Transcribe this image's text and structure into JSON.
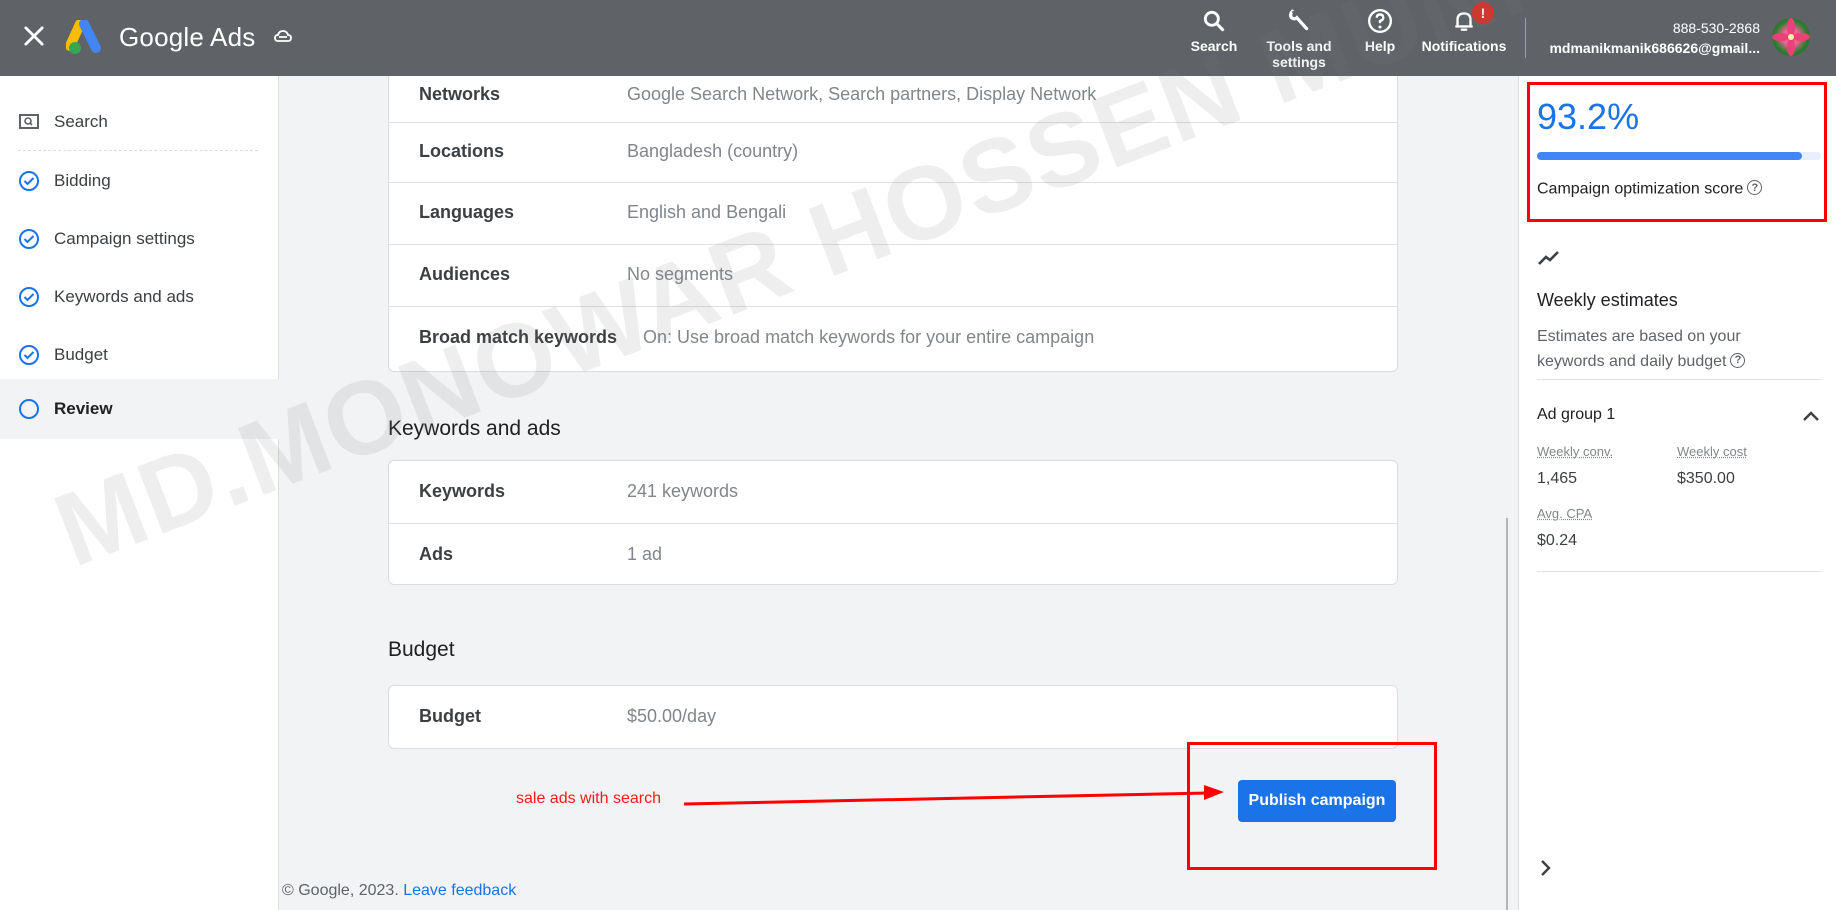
{
  "header": {
    "brand": "Google Ads",
    "buttons": [
      {
        "label": "Search",
        "icon": "search-icon"
      },
      {
        "label": "Tools and settings",
        "line1": "Tools and",
        "line2": "settings",
        "icon": "wrench-icon"
      },
      {
        "label": "Help",
        "icon": "help-icon"
      },
      {
        "label": "Notifications",
        "icon": "bell-icon",
        "badge": "!"
      }
    ],
    "account": {
      "phone": "888-530-2868",
      "email": "mdmanikmanik686626@gmail..."
    }
  },
  "leftnav": {
    "items": [
      {
        "label": "Search",
        "icon": "search-campaign-icon",
        "state": "type"
      },
      {
        "label": "Bidding",
        "icon": "check-circle-icon",
        "state": "done"
      },
      {
        "label": "Campaign settings",
        "icon": "check-circle-icon",
        "state": "done"
      },
      {
        "label": "Keywords and ads",
        "icon": "check-circle-icon",
        "state": "done"
      },
      {
        "label": "Budget",
        "icon": "check-circle-icon",
        "state": "done"
      },
      {
        "label": "Review",
        "icon": "empty-circle-icon",
        "state": "active"
      }
    ]
  },
  "main": {
    "settings_rows": [
      {
        "key": "Networks",
        "value": "Google Search Network, Search partners, Display Network"
      },
      {
        "key": "Locations",
        "value": "Bangladesh (country)"
      },
      {
        "key": "Languages",
        "value": "English and Bengali"
      },
      {
        "key": "Audiences",
        "value": "No segments"
      },
      {
        "key": "Broad match keywords",
        "value": "On: Use broad match keywords for your entire campaign"
      }
    ],
    "keywords_section": {
      "title": "Keywords and ads",
      "rows": [
        {
          "key": "Keywords",
          "value": "241 keywords"
        },
        {
          "key": "Ads",
          "value": "1 ad"
        }
      ]
    },
    "budget_section": {
      "title": "Budget",
      "rows": [
        {
          "key": "Budget",
          "value": "$50.00/day"
        }
      ]
    },
    "annotation": "sale ads with search",
    "publish_label": "Publish campaign",
    "footer": {
      "copyright": "© Google, 2023.",
      "feedback_link": "Leave feedback"
    }
  },
  "rightpanel": {
    "optimization_score": "93.2%",
    "optimization_score_value": 93.2,
    "optimization_label": "Campaign optimization score",
    "weekly_title": "Weekly estimates",
    "weekly_desc": "Estimates are based on your keywords and daily budget",
    "ad_group": {
      "name": "Ad group 1",
      "metrics": [
        {
          "label": "Weekly conv.",
          "value": "1,465"
        },
        {
          "label": "Weekly cost",
          "value": "$350.00"
        },
        {
          "label": "Avg. CPA",
          "value": "$0.24"
        }
      ]
    }
  },
  "watermark": "MD.MONOWAR HOSSEN MUNNA",
  "colors": {
    "accent": "#1a73e8",
    "header_bg": "#5f6368",
    "annotation_red": "#ff0000",
    "badge_red": "#d93025"
  }
}
